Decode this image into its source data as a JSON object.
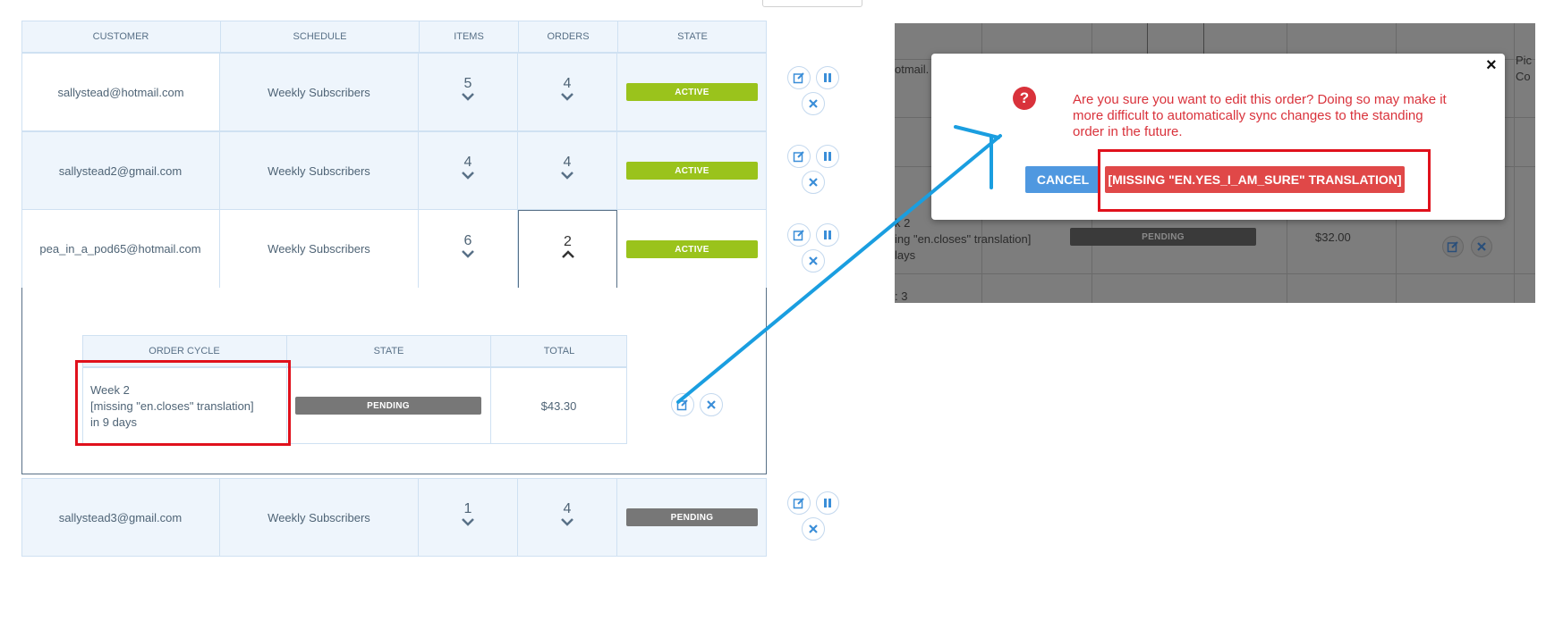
{
  "table": {
    "headers": [
      "CUSTOMER",
      "SCHEDULE",
      "ITEMS",
      "ORDERS",
      "STATE"
    ],
    "rows": [
      {
        "customer": "sallystead@hotmail.com",
        "schedule": "Weekly Subscribers",
        "items": "5",
        "orders": "4",
        "state": "ACTIVE"
      },
      {
        "customer": "sallystead2@gmail.com",
        "schedule": "Weekly Subscribers",
        "items": "4",
        "orders": "4",
        "state": "ACTIVE"
      },
      {
        "customer": "pea_in_a_pod65@hotmail.com",
        "schedule": "Weekly Subscribers",
        "items": "6",
        "orders": "2",
        "state": "ACTIVE"
      },
      {
        "customer": "sallystead3@gmail.com",
        "schedule": "Weekly Subscribers",
        "items": "1",
        "orders": "4",
        "state": "PENDING"
      }
    ]
  },
  "orders_panel": {
    "headers": [
      "ORDER CYCLE",
      "STATE",
      "TOTAL"
    ],
    "row": {
      "cycle_line1": "Week 2",
      "cycle_line2": "[missing \"en.closes\" translation]",
      "cycle_line3": "in 9 days",
      "state": "PENDING",
      "total": "$43.30"
    }
  },
  "background_snippet": {
    "email_fragment": "otmail.",
    "pick_fragment_1": "Pic",
    "pick_fragment_2": "Co",
    "week_fragment": "k 2",
    "closes_fragment": "ing \"en.closes\" translation]",
    "days_fragment": "lays",
    "state": "PENDING",
    "total": "$32.00",
    "cycle3_fragment": ": 3"
  },
  "dialog": {
    "message": "Are you sure you want to edit this order? Doing so may make it more difficult to automatically sync changes to the standing order in the future.",
    "cancel_label": "CANCEL",
    "confirm_label": "[MISSING \"EN.YES_I_AM_SURE\" TRANSLATION]",
    "close_label": "×"
  },
  "colors": {
    "active": "#9ac31c",
    "pending": "#777777",
    "cancel_button": "#4f98e0",
    "confirm_button": "#e04848",
    "highlight_box": "#e0111c",
    "annotation_arrow": "#1a9ee0"
  },
  "icons": [
    "edit-icon",
    "pause-icon",
    "close-x-icon",
    "question-icon",
    "chevron-down-icon",
    "chevron-up-icon"
  ]
}
